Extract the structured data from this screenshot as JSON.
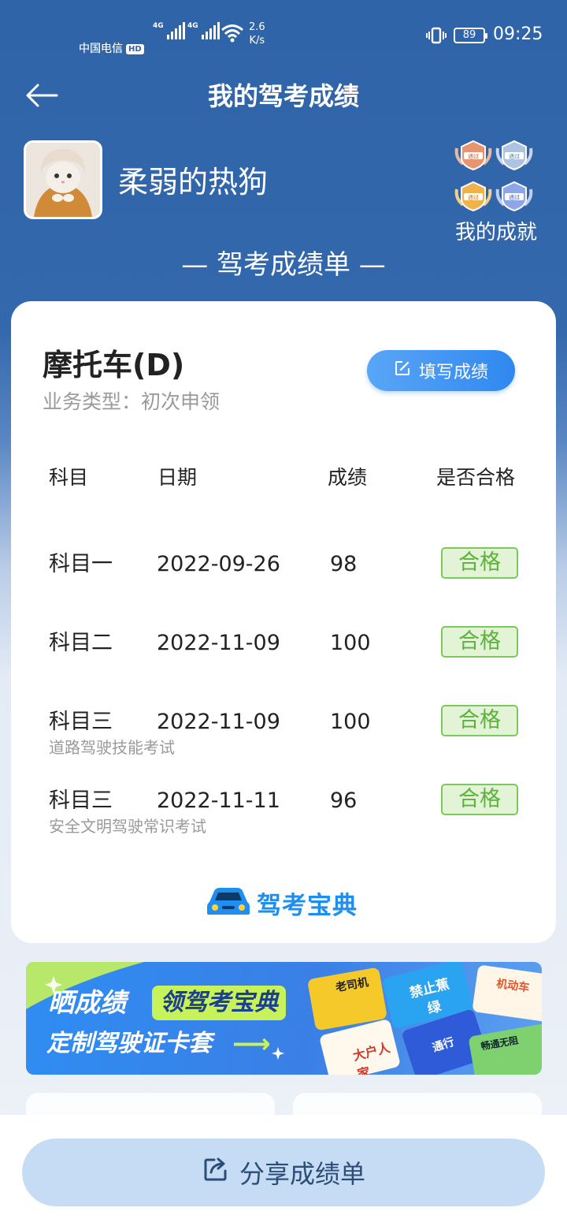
{
  "status_bar": {
    "carrier1": "中国电信",
    "carrier2": "中国电信",
    "hd_badge": "HD",
    "network_tag": "4G",
    "speed_value": "2.6",
    "speed_unit": "K/s",
    "battery": "89",
    "time": "09:25"
  },
  "header": {
    "title": "我的驾考成绩"
  },
  "profile": {
    "username": "柔弱的热狗",
    "achievements_label": "我的成就",
    "medal_text": "通过"
  },
  "report_title": "— 驾考成绩单 —",
  "card": {
    "vehicle": "摩托车(D)",
    "business_type": "业务类型：初次申领",
    "fill_button": "填写成绩",
    "columns": [
      "科目",
      "日期",
      "成绩",
      "是否合格"
    ],
    "rows": [
      {
        "subject": "科目一",
        "date": "2022-09-26",
        "score": "98",
        "result": "合格",
        "note": ""
      },
      {
        "subject": "科目二",
        "date": "2022-11-09",
        "score": "100",
        "result": "合格",
        "note": ""
      },
      {
        "subject": "科目三",
        "date": "2022-11-09",
        "score": "100",
        "result": "合格",
        "note": "道路驾驶技能考试"
      },
      {
        "subject": "科目三",
        "date": "2022-11-11",
        "score": "96",
        "result": "合格",
        "note": "安全文明驾驶常识考试"
      }
    ],
    "brand": "驾考宝典"
  },
  "banner": {
    "line1": "晒成绩",
    "highlight": "领驾考宝典",
    "line2": "定制驾驶证卡套",
    "card_texts": [
      "老司机",
      "禁止蕉绿",
      "机动车",
      "大户人家",
      "通行",
      "畅通无阻"
    ]
  },
  "bottom": {
    "share_button": "分享成绩单"
  },
  "colors": {
    "primary_bg": "#2f64a8",
    "accent_blue": "#2f88f0",
    "pass_green": "#5cb23c",
    "banner_lime": "#c8f25a"
  }
}
